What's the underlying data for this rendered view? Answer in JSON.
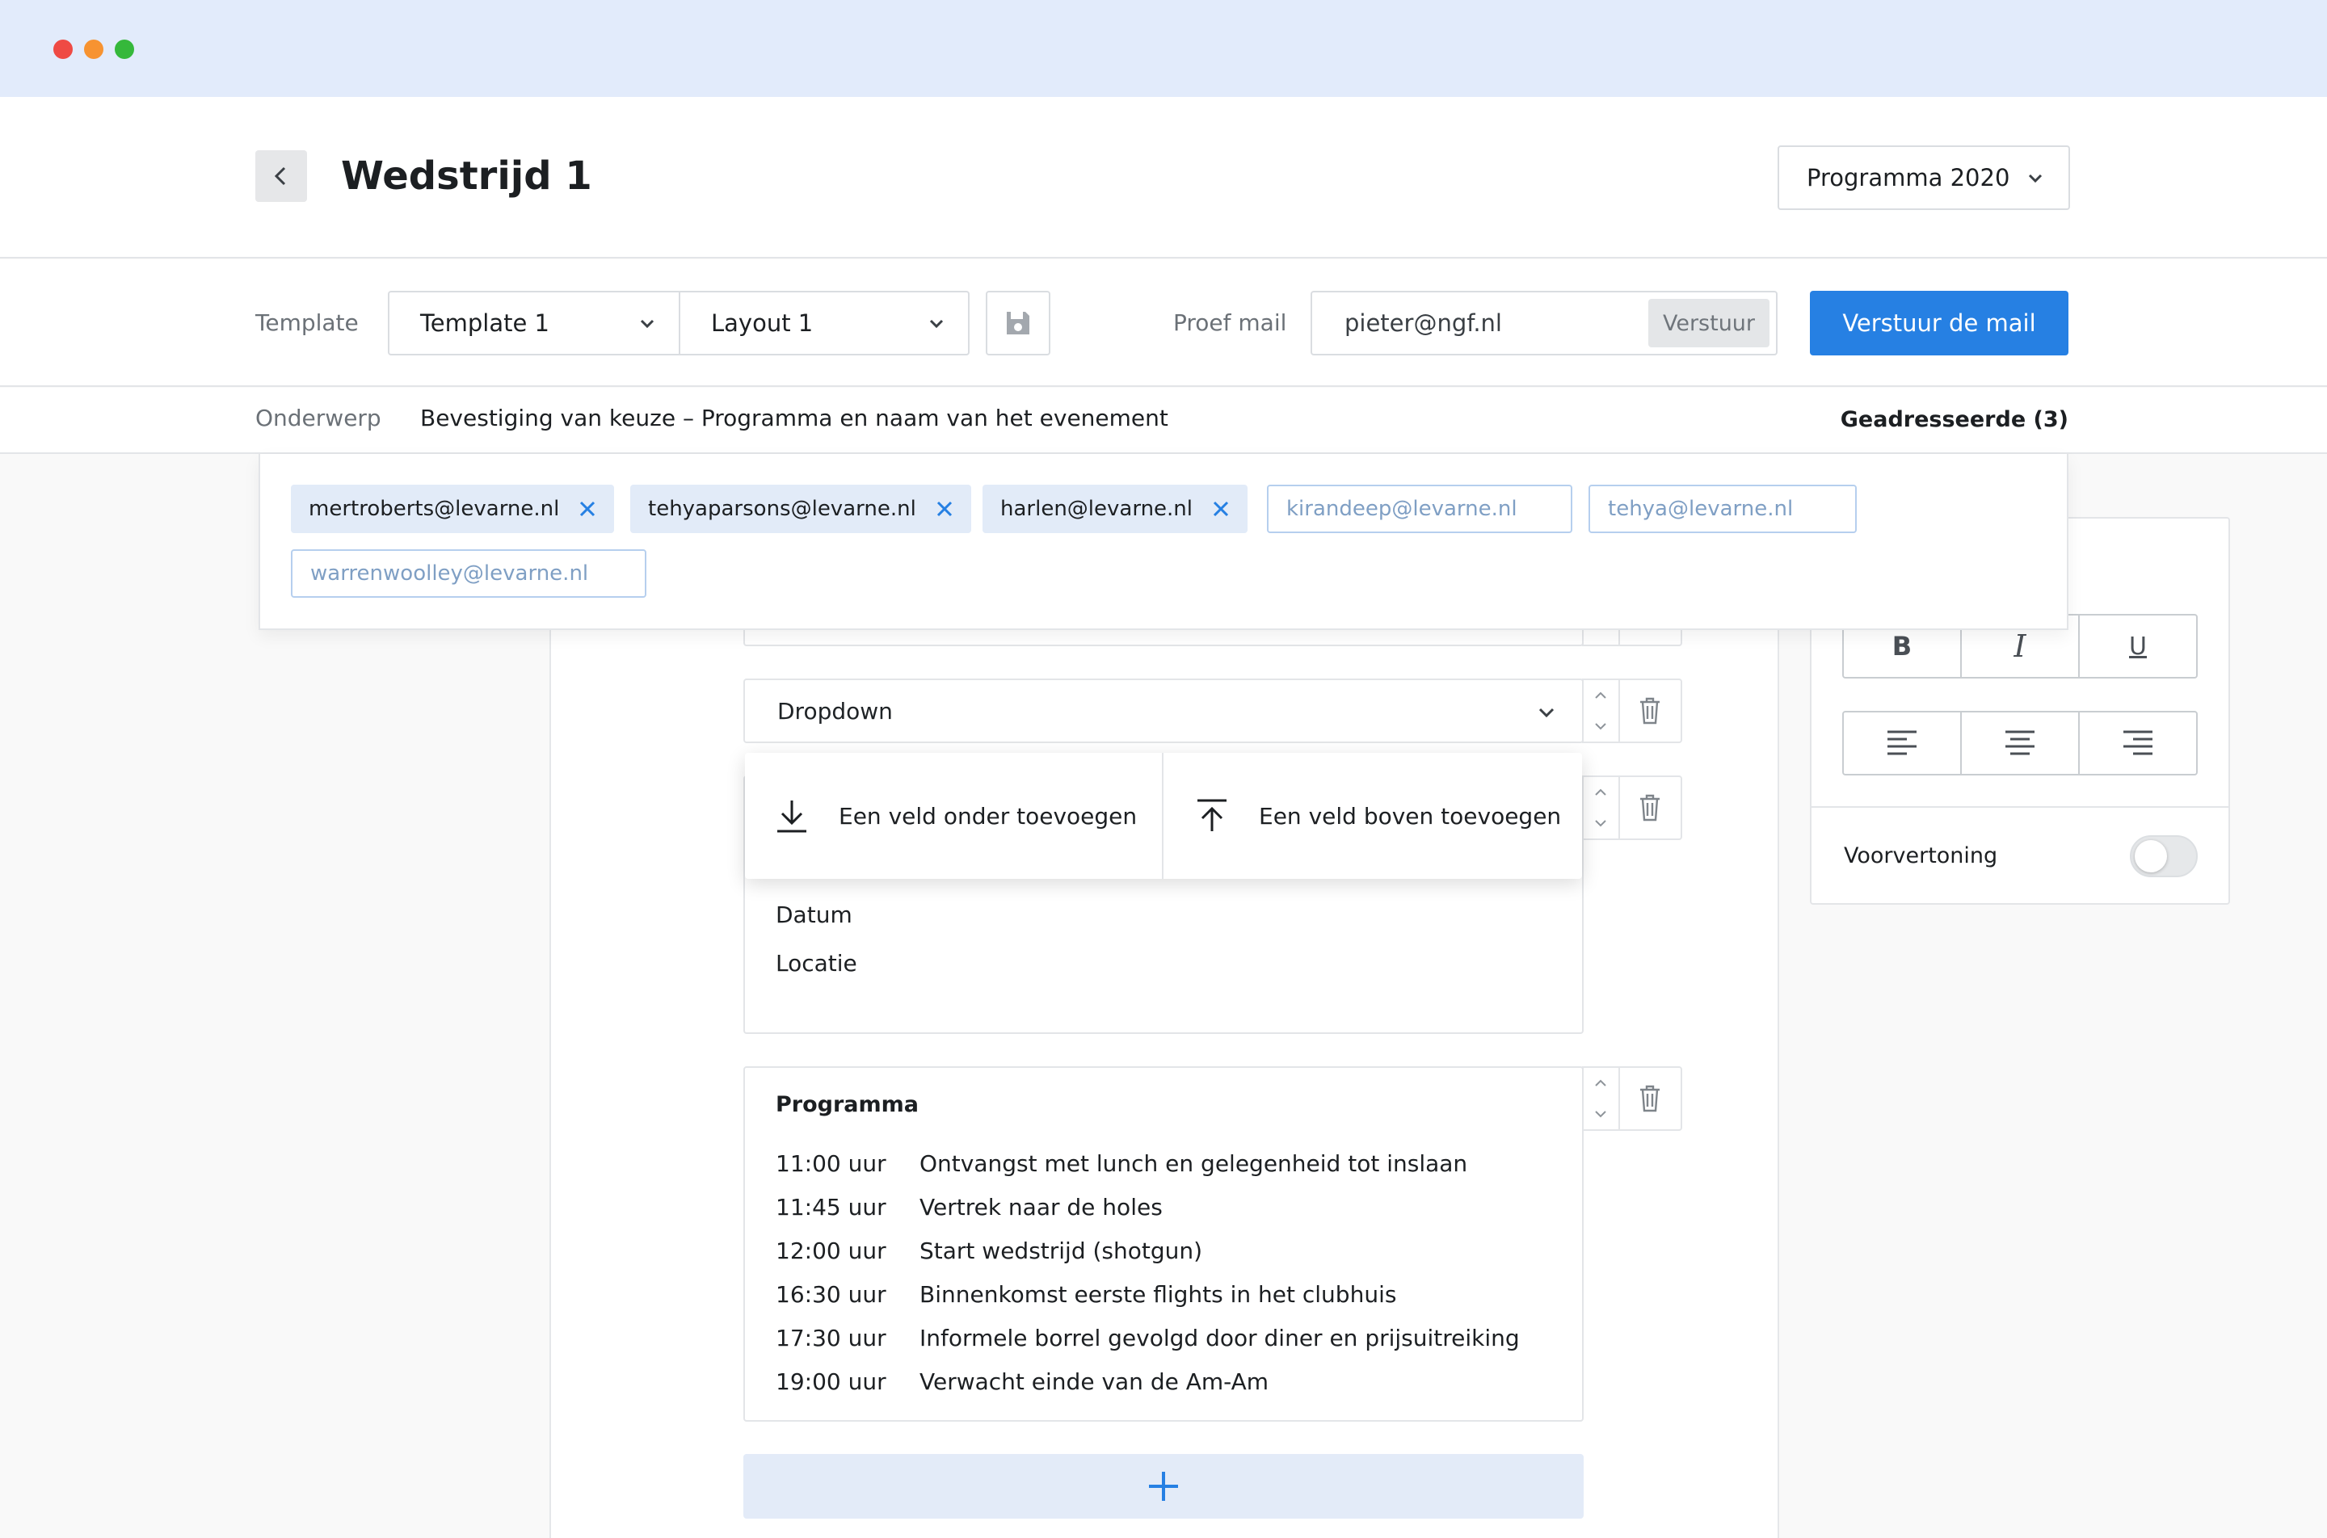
{
  "window": {
    "traffic_lights": [
      "#ef4a44",
      "#f79331",
      "#35b83b"
    ]
  },
  "header": {
    "title": "Wedstrijd 1",
    "back_icon": "chevron-left-icon",
    "program_select": "Programma 2020"
  },
  "toolbar": {
    "template_label": "Template",
    "template_value": "Template 1",
    "layout_value": "Layout 1",
    "save_icon": "floppy-disk-icon",
    "proef_label": "Proef mail",
    "proef_value": "pieter@ngf.nl",
    "proef_send": "Verstuur",
    "send_button": "Verstuur de mail"
  },
  "subject": {
    "label": "Onderwerp",
    "text": "Bevestiging van keuze – Programma en naam van het evenement",
    "recipients_label": "Geadresseerde (3)"
  },
  "recipients": {
    "selected": [
      "mertroberts@levarne.nl",
      "tehyaparsons@levarne.nl",
      "harlen@levarne.nl"
    ],
    "unselected": [
      "kirandeep@levarne.nl",
      "tehya@levarne.nl",
      "warrenwoolley@levarne.nl"
    ]
  },
  "editor": {
    "dropdown_label": "Dropdown",
    "popover": {
      "add_below": "Een veld onder toevoegen",
      "add_above": "Een veld boven toevoegen"
    },
    "text_lines": [
      "Datum",
      "Locatie"
    ],
    "program": {
      "title": "Programma",
      "rows": [
        {
          "time": "11:00 uur",
          "text": "Ontvangst met lunch en gelegenheid tot inslaan"
        },
        {
          "time": "11:45 uur",
          "text": "Vertrek naar de holes"
        },
        {
          "time": "12:00 uur",
          "text": "Start wedstrijd (shotgun)"
        },
        {
          "time": "16:30 uur",
          "text": "Binnenkomst eerste flights in het clubhuis"
        },
        {
          "time": "17:30 uur",
          "text": "Informele borrel gevolgd door diner en prijsuitreiking"
        },
        {
          "time": "19:00 uur",
          "text": "Verwacht einde van de Am-Am"
        }
      ]
    },
    "add_icon": "plus-icon"
  },
  "format_panel": {
    "bold": "B",
    "italic": "I",
    "underline": "U",
    "align_icons": [
      "align-left-icon",
      "align-center-icon",
      "align-right-icon"
    ],
    "preview_label": "Voorvertoning",
    "preview_on": false
  },
  "colors": {
    "accent": "#2680e3",
    "chip_bg": "#e2ebf8",
    "chip_border": "#b6cfee",
    "titlebar": "#e2ebfb"
  }
}
